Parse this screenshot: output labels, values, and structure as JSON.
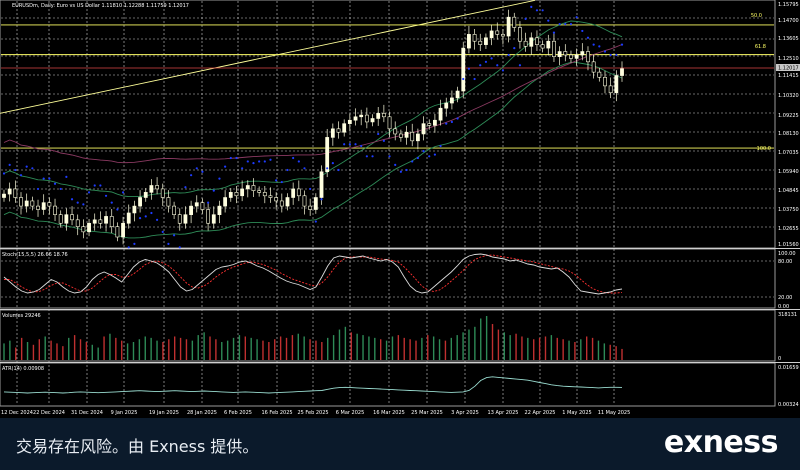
{
  "panels": {
    "main": {
      "header": "EURUSDm, Daily: Euro vs US Dollar 1.11810 1.12288 1.11759 1.12017",
      "price_labels": [
        "1.15795",
        "1.14700",
        "1.13605",
        "1.12510",
        "1.11415",
        "1.10320",
        "1.09225",
        "1.08130",
        "1.07035",
        "1.05940",
        "1.04845",
        "1.03750",
        "1.02655",
        "1.01560"
      ],
      "current_price": "1.12017",
      "fib_labels": [
        "50.0",
        "61.8",
        "100.0"
      ]
    },
    "stoch": {
      "header": "Stoch(15,5,5) 26.66 18.76",
      "labels": [
        "100.00",
        "80.00",
        "20.00",
        "0.00"
      ]
    },
    "volumes": {
      "header": "Volumes 29246",
      "labels": [
        "318131",
        "0"
      ]
    },
    "atr": {
      "header": "ATR(14) 0.00908",
      "labels": [
        "0.01659",
        "0.00324"
      ]
    }
  },
  "x_axis_labels": [
    "12 Dec 2024",
    "22 Dec 2024",
    "31 Dec 2024",
    "9 Jan 2025",
    "19 Jan 2025",
    "28 Jan 2025",
    "6 Feb 2025",
    "16 Feb 2025",
    "25 Feb 2025",
    "6 Mar 2025",
    "16 Mar 2025",
    "25 Mar 2025",
    "3 Apr 2025",
    "13 Apr 2025",
    "22 Apr 2025",
    "1 May 2025",
    "11 May 2025"
  ],
  "footer": {
    "disclaimer": "交易存在风险。由 Exness 提供。",
    "brand": "exness"
  },
  "colors": {
    "background": "#000000",
    "bull_candle": "#ffffe0",
    "bear_candle": "#ffffe0",
    "fib_line": "#ffff66",
    "parabolic_sar": "#1e3cff",
    "ma_fast": "#2e8b57",
    "ma_slow": "#8b3a62",
    "stoch_main": "#dcdcdc",
    "stoch_signal": "#ff3030",
    "volume_up": "#2e8b57",
    "volume_down": "#c03030",
    "atr_line": "#9adcd0"
  },
  "chart_data": {
    "type": "candlestick",
    "symbol": "EURUSDm",
    "timeframe": "Daily",
    "title": "EURUSDm, Daily: Euro vs US Dollar",
    "ohlc_last": {
      "open": 1.1181,
      "high": 1.12288,
      "low": 1.11759,
      "close": 1.12017
    },
    "ylim": [
      1.0156,
      1.16
    ],
    "x_labels": [
      "12 Dec 2024",
      "22 Dec 2024",
      "31 Dec 2024",
      "9 Jan 2025",
      "19 Jan 2025",
      "28 Jan 2025",
      "6 Feb 2025",
      "16 Feb 2025",
      "25 Feb 2025",
      "6 Mar 2025",
      "16 Mar 2025",
      "25 Mar 2025",
      "3 Apr 2025",
      "13 Apr 2025",
      "22 Apr 2025",
      "1 May 2025",
      "11 May 2025"
    ],
    "close_path": [
      1.047,
      1.05,
      1.045,
      1.04,
      1.043,
      1.04,
      1.038,
      1.042,
      1.04,
      1.035,
      1.03,
      1.035,
      1.032,
      1.028,
      1.025,
      1.03,
      1.032,
      1.03,
      1.034,
      1.028,
      1.022,
      1.03,
      1.036,
      1.04,
      1.045,
      1.048,
      1.052,
      1.05,
      1.045,
      1.04,
      1.035,
      1.03,
      1.035,
      1.04,
      1.042,
      1.038,
      1.03,
      1.035,
      1.04,
      1.045,
      1.048,
      1.046,
      1.05,
      1.052,
      1.049,
      1.048,
      1.046,
      1.045,
      1.043,
      1.04,
      1.045,
      1.05,
      1.046,
      1.04,
      1.038,
      1.045,
      1.06,
      1.08,
      1.085,
      1.083,
      1.088,
      1.09,
      1.092,
      1.093,
      1.089,
      1.091,
      1.094,
      1.092,
      1.085,
      1.082,
      1.08,
      1.083,
      1.078,
      1.082,
      1.088,
      1.087,
      1.09,
      1.097,
      1.1,
      1.103,
      1.107,
      1.132,
      1.14,
      1.136,
      1.134,
      1.138,
      1.142,
      1.14,
      1.139,
      1.15,
      1.144,
      1.136,
      1.133,
      1.138,
      1.134,
      1.132,
      1.136,
      1.127,
      1.13,
      1.128,
      1.126,
      1.128,
      1.13,
      1.124,
      1.118,
      1.115,
      1.11,
      1.106,
      1.116,
      1.12
    ],
    "fibonacci_levels": [
      {
        "label": "50.0",
        "price": 1.1455
      },
      {
        "label": "61.8",
        "price": 1.1282
      },
      {
        "label": "100.0",
        "price": 1.0738
      }
    ],
    "horizontal_lines": [
      1.1204
    ],
    "trendline": {
      "from": {
        "x": "12 Dec 2024",
        "y": 1.094
      },
      "to": {
        "x": "22 Apr 2025",
        "y": 1.1598
      }
    },
    "stoch_last": {
      "main": 26.66,
      "signal": 18.76
    },
    "stoch_levels": [
      80,
      20
    ],
    "stoch_main": [
      50,
      40,
      30,
      22,
      18,
      20,
      25,
      35,
      45,
      40,
      30,
      22,
      18,
      20,
      30,
      45,
      55,
      60,
      55,
      48,
      40,
      55,
      70,
      80,
      85,
      82,
      78,
      70,
      60,
      45,
      30,
      22,
      25,
      35,
      45,
      55,
      65,
      70,
      72,
      75,
      80,
      82,
      78,
      72,
      68,
      62,
      55,
      48,
      42,
      38,
      35,
      30,
      25,
      30,
      50,
      72,
      88,
      92,
      90,
      88,
      90,
      92,
      88,
      85,
      82,
      85,
      80,
      70,
      50,
      32,
      22,
      18,
      20,
      30,
      40,
      50,
      60,
      72,
      85,
      92,
      95,
      96,
      94,
      90,
      88,
      86,
      82,
      84,
      80,
      76,
      74,
      70,
      68,
      66,
      68,
      60,
      50,
      35,
      22,
      20,
      18,
      16,
      18,
      20,
      24,
      26
    ],
    "stoch_signal": [
      45,
      45,
      38,
      30,
      24,
      20,
      21,
      26,
      33,
      38,
      38,
      33,
      27,
      22,
      22,
      28,
      38,
      48,
      55,
      55,
      50,
      50,
      56,
      65,
      75,
      80,
      82,
      78,
      72,
      62,
      50,
      38,
      30,
      28,
      32,
      40,
      50,
      58,
      65,
      70,
      74,
      78,
      80,
      78,
      75,
      70,
      65,
      58,
      52,
      46,
      42,
      38,
      34,
      32,
      38,
      50,
      66,
      80,
      88,
      90,
      90,
      90,
      90,
      88,
      86,
      85,
      83,
      80,
      70,
      58,
      45,
      32,
      24,
      21,
      24,
      32,
      42,
      52,
      63,
      75,
      85,
      90,
      93,
      94,
      92,
      90,
      88,
      86,
      84,
      82,
      80,
      77,
      74,
      71,
      68,
      66,
      62,
      55,
      45,
      35,
      27,
      22,
      19,
      18,
      18,
      19
    ],
    "volumes_max": 318131,
    "volumes_last": 29246,
    "volumes": [
      120,
      140,
      90,
      160,
      130,
      110,
      150,
      170,
      140,
      120,
      100,
      160,
      180,
      150,
      130,
      110,
      90,
      170,
      190,
      160,
      140,
      120,
      130,
      150,
      170,
      160,
      140,
      130,
      150,
      170,
      160,
      150,
      140,
      180,
      200,
      170,
      150,
      130,
      140,
      160,
      180,
      170,
      160,
      150,
      140,
      130,
      150,
      170,
      160,
      180,
      190,
      170,
      150,
      140,
      130,
      160,
      180,
      220,
      240,
      200,
      190,
      180,
      170,
      160,
      150,
      140,
      170,
      180,
      160,
      150,
      140,
      160,
      180,
      170,
      150,
      140,
      160,
      180,
      200,
      220,
      240,
      300,
      318,
      260,
      220,
      200,
      180,
      190,
      170,
      160,
      150,
      160,
      170,
      180,
      160,
      150,
      140,
      130,
      150,
      170,
      160,
      140,
      120,
      110,
      100,
      80
    ],
    "atr_last": 0.00908,
    "atr_ylim": [
      0.00324,
      0.01659
    ],
    "atr": [
      0.0075,
      0.0074,
      0.0073,
      0.0072,
      0.0071,
      0.0072,
      0.0073,
      0.0074,
      0.0073,
      0.0072,
      0.0071,
      0.0072,
      0.0074,
      0.0075,
      0.0074,
      0.0073,
      0.0072,
      0.0073,
      0.0074,
      0.0075,
      0.0076,
      0.0077,
      0.0078,
      0.0079,
      0.0078,
      0.0077,
      0.0076,
      0.0077,
      0.0078,
      0.0079,
      0.0078,
      0.0077,
      0.0076,
      0.0077,
      0.0078,
      0.0077,
      0.0076,
      0.0075,
      0.0074,
      0.0073,
      0.0074,
      0.0075,
      0.0074,
      0.0073,
      0.0072,
      0.0071,
      0.0072,
      0.0073,
      0.0074,
      0.0075,
      0.0076,
      0.0077,
      0.0078,
      0.0079,
      0.008,
      0.0084,
      0.0088,
      0.009,
      0.0091,
      0.009,
      0.0089,
      0.0088,
      0.0087,
      0.0086,
      0.0085,
      0.0084,
      0.0083,
      0.0082,
      0.0081,
      0.008,
      0.0079,
      0.0078,
      0.0077,
      0.0076,
      0.0075,
      0.0074,
      0.0073,
      0.0074,
      0.0075,
      0.008,
      0.0095,
      0.0115,
      0.0125,
      0.0128,
      0.0126,
      0.0124,
      0.0122,
      0.012,
      0.0118,
      0.0116,
      0.0112,
      0.0108,
      0.0104,
      0.01,
      0.0097,
      0.0095,
      0.0094,
      0.0093,
      0.0092,
      0.0091,
      0.009,
      0.0089,
      0.009,
      0.0091,
      0.0091,
      0.00908
    ]
  }
}
